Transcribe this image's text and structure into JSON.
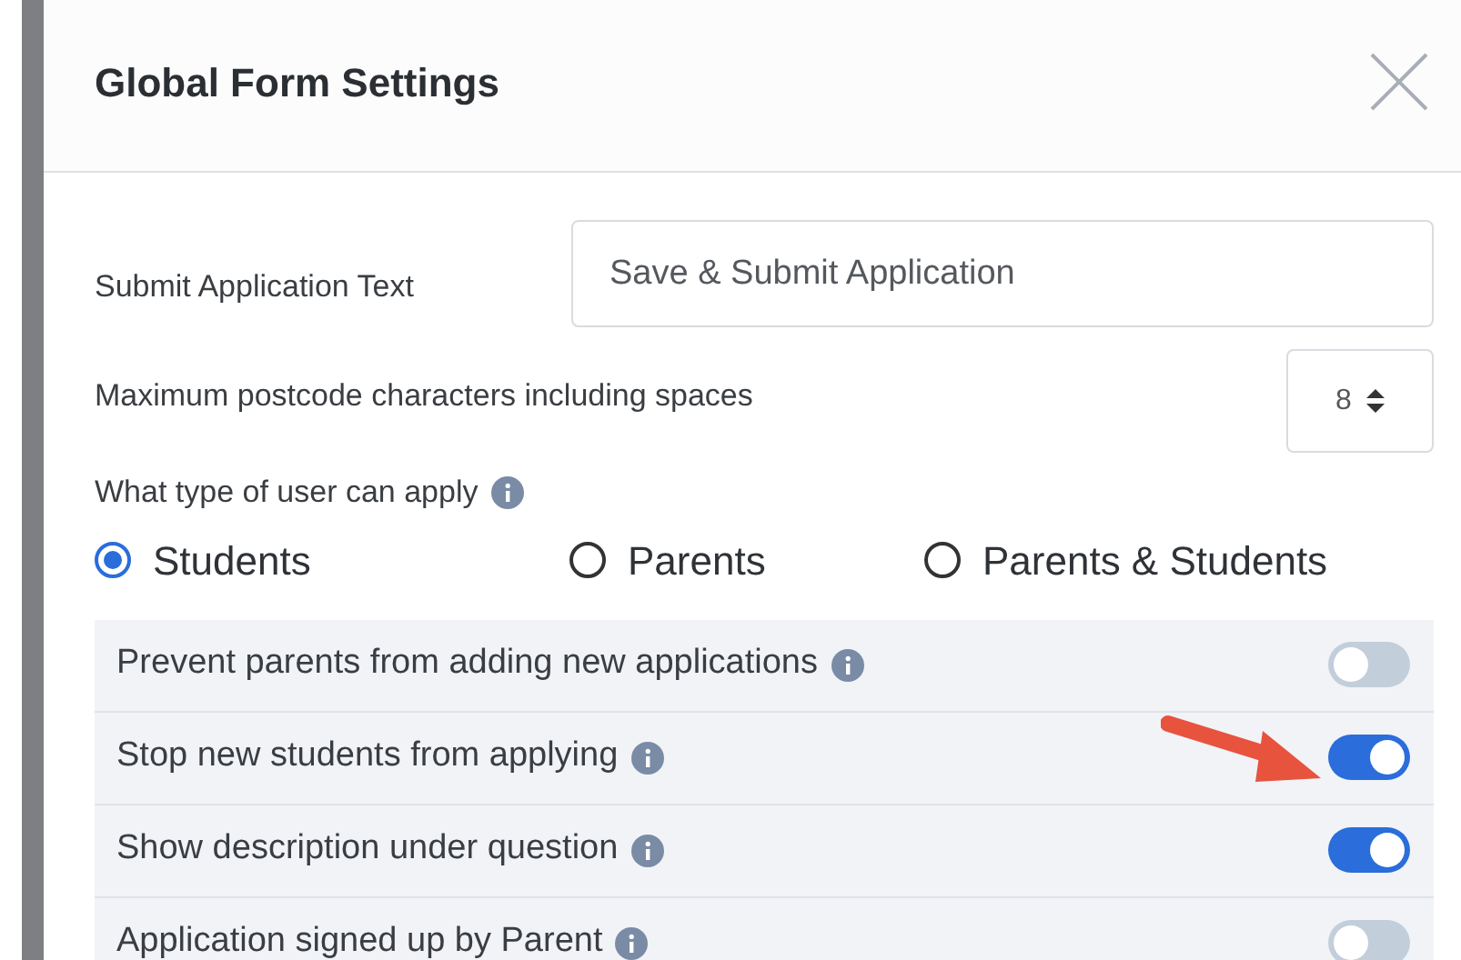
{
  "dialog": {
    "title": "Global Form Settings"
  },
  "submit_text": {
    "label": "Submit Application Text",
    "value": "Save & Submit Application"
  },
  "postcode": {
    "label": "Maximum postcode characters including spaces",
    "value": "8"
  },
  "user_type": {
    "label": "What type of user can apply",
    "options": [
      {
        "label": "Students",
        "selected": true
      },
      {
        "label": "Parents",
        "selected": false
      },
      {
        "label": "Parents & Students",
        "selected": false
      }
    ]
  },
  "toggles": [
    {
      "label": "Prevent parents from adding new applications",
      "on": false
    },
    {
      "label": "Stop new students from applying",
      "on": true
    },
    {
      "label": "Show description under question",
      "on": true
    },
    {
      "label": "Application signed up by Parent",
      "on": false
    }
  ]
}
